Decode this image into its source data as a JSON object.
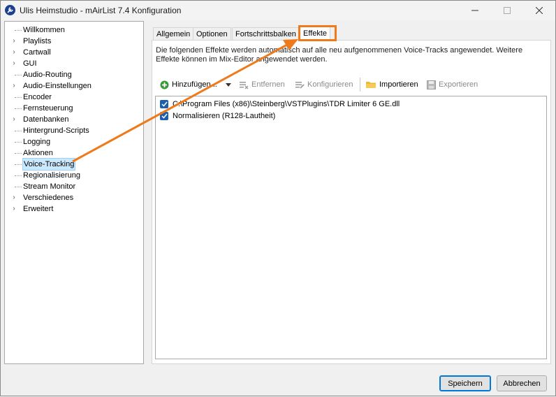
{
  "window": {
    "title": "Ulis Heimstudio - mAirList 7.4 Konfiguration",
    "minimize_icon": "minimize-icon",
    "maximize_icon": "maximize-icon",
    "close_icon": "close-icon"
  },
  "tree": {
    "items": [
      {
        "label": "Willkommen",
        "expandable": false
      },
      {
        "label": "Playlists",
        "expandable": true
      },
      {
        "label": "Cartwall",
        "expandable": true
      },
      {
        "label": "GUI",
        "expandable": true
      },
      {
        "label": "Audio-Routing",
        "expandable": false
      },
      {
        "label": "Audio-Einstellungen",
        "expandable": true
      },
      {
        "label": "Encoder",
        "expandable": false
      },
      {
        "label": "Fernsteuerung",
        "expandable": false
      },
      {
        "label": "Datenbanken",
        "expandable": true
      },
      {
        "label": "Hintergrund-Scripts",
        "expandable": false
      },
      {
        "label": "Logging",
        "expandable": false
      },
      {
        "label": "Aktionen",
        "expandable": false
      },
      {
        "label": "Voice-Tracking",
        "expandable": false,
        "selected": true
      },
      {
        "label": "Regionalisierung",
        "expandable": false
      },
      {
        "label": "Stream Monitor",
        "expandable": false
      },
      {
        "label": "Verschiedenes",
        "expandable": true
      },
      {
        "label": "Erweitert",
        "expandable": true
      }
    ]
  },
  "tabs": [
    {
      "label": "Allgemein"
    },
    {
      "label": "Optionen"
    },
    {
      "label": "Fortschrittsbalken"
    },
    {
      "label": "Effekte",
      "active": true
    }
  ],
  "effects": {
    "description": "Die folgenden Effekte werden automatisch auf alle neu aufgenommenen Voice-Tracks angewendet. Weitere Effekte können im Mix-Editor angewendet werden.",
    "toolbar": {
      "add": "Hinzufügen...",
      "remove": "Entfernen",
      "configure": "Konfigurieren",
      "import": "Importieren",
      "export": "Exportieren"
    },
    "items": [
      {
        "label": "C:\\Program Files (x86)\\Steinberg\\VSTPlugins\\TDR Limiter 6 GE.dll",
        "checked": true
      },
      {
        "label": "Normalisieren (R128-Lautheit)",
        "checked": true
      }
    ]
  },
  "buttons": {
    "save": "Speichern",
    "cancel": "Abbrechen"
  },
  "colors": {
    "annotation": "#ee7a1b",
    "selection": "#cce8ff",
    "checkbox": "#1b5fb0"
  }
}
